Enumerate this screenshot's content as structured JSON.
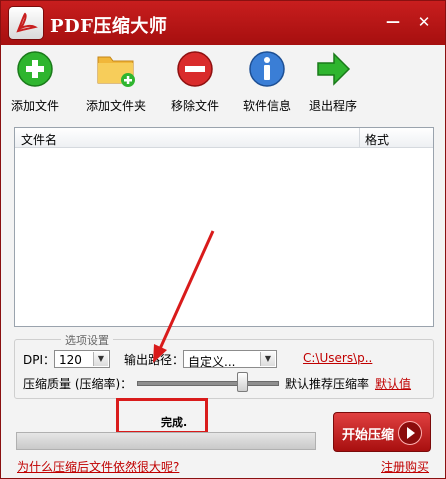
{
  "window": {
    "title": "PDF压缩大师",
    "min_glyph": "—",
    "close_glyph": "✕"
  },
  "toolbar": {
    "items": [
      {
        "label": "添加文件",
        "icon": "add-icon"
      },
      {
        "label": "添加文件夹",
        "icon": "add-folder-icon"
      },
      {
        "label": "移除文件",
        "icon": "remove-icon"
      },
      {
        "label": "软件信息",
        "icon": "info-icon"
      },
      {
        "label": "退出程序",
        "icon": "exit-arrow-icon"
      }
    ]
  },
  "file_list": {
    "columns": [
      "文件名",
      "格式"
    ],
    "rows": []
  },
  "options": {
    "legend": "选项设置",
    "dpi_label": "DPI：",
    "dpi_value": "120",
    "output_label": "输出路径：",
    "output_value": "自定义...",
    "output_path": "C:\\Users\\p..",
    "quality_label": "压缩质量 (压缩率)：",
    "quality_value": 0.75,
    "default_rate_label": "默认推荐压缩率",
    "default_link": "默认值"
  },
  "status": {
    "text": "完成.",
    "progress": 0
  },
  "actions": {
    "start_label": "开始压缩",
    "why_link": "为什么压缩后文件依然很大呢?",
    "register_link": "注册购买"
  },
  "colors": {
    "titlebar": "#b81616",
    "accent_red": "#c00000",
    "annotation_red": "#d91b1b"
  }
}
